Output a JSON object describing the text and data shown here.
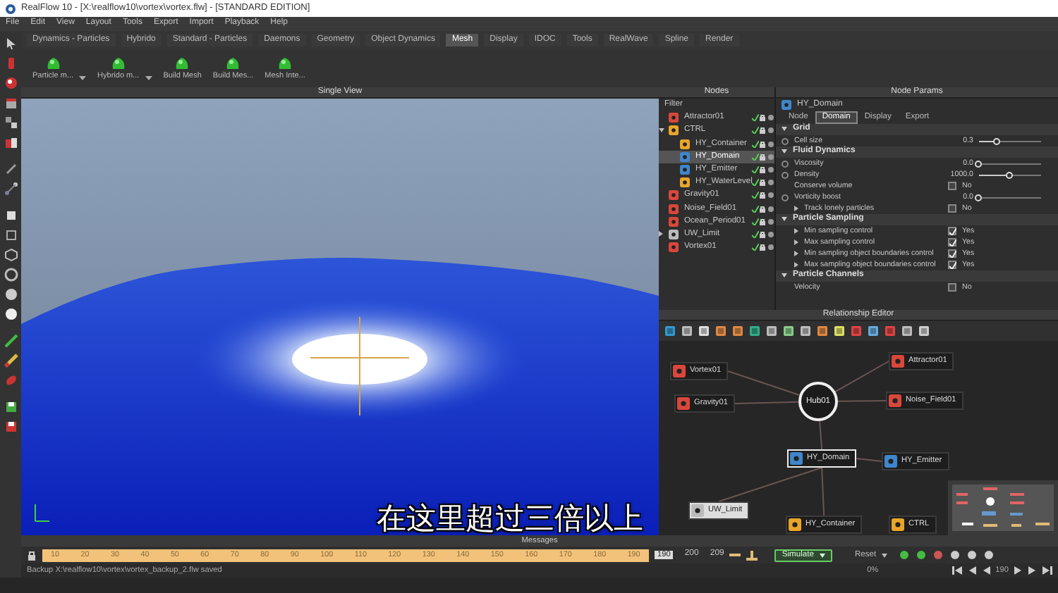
{
  "window": {
    "title": "RealFlow 10 - [X:\\realflow10\\vortex\\vortex.flw] - [STANDARD EDITION]"
  },
  "menu": [
    "File",
    "Edit",
    "View",
    "Layout",
    "Tools",
    "Export",
    "Import",
    "Playback",
    "Help"
  ],
  "shelf_tabs": [
    {
      "label": "Dynamics - Particles",
      "selected": false
    },
    {
      "label": "Hybrido",
      "selected": false
    },
    {
      "label": "Standard - Particles",
      "selected": false
    },
    {
      "label": "Daemons",
      "selected": false
    },
    {
      "label": "Geometry",
      "selected": false
    },
    {
      "label": "Object Dynamics",
      "selected": false
    },
    {
      "label": "Mesh",
      "selected": true
    },
    {
      "label": "Display",
      "selected": false
    },
    {
      "label": "IDOC",
      "selected": false
    },
    {
      "label": "Tools",
      "selected": false
    },
    {
      "label": "RealWave",
      "selected": false
    },
    {
      "label": "Spline",
      "selected": false
    },
    {
      "label": "Render",
      "selected": false
    }
  ],
  "shelf_tools": [
    {
      "label": "Particle m...",
      "menu": true
    },
    {
      "label": "Hybrido m...",
      "menu": true
    },
    {
      "label": "Build Mesh",
      "menu": false
    },
    {
      "label": "Build Mes...",
      "menu": false
    },
    {
      "label": "Mesh Inte...",
      "menu": false
    }
  ],
  "viewport": {
    "title": "Single View",
    "subtitle": "在这里超过三倍以上"
  },
  "nodes_panel": {
    "title": "Nodes",
    "filter_label": "Filter",
    "items": [
      {
        "label": "Attractor01",
        "color": "#d9473c",
        "selected": false
      },
      {
        "label": "CTRL",
        "color": "#e8a52a",
        "selected": false,
        "expanded": true,
        "children": [
          {
            "label": "HY_Container",
            "color": "#e8a52a",
            "selected": false
          },
          {
            "label": "HY_Domain",
            "color": "#3f86cc",
            "selected": true
          },
          {
            "label": "HY_Emitter",
            "color": "#3f86cc",
            "selected": false
          },
          {
            "label": "HY_WaterLevel",
            "color": "#e8a52a",
            "selected": false
          }
        ]
      },
      {
        "label": "Gravity01",
        "color": "#d9473c",
        "selected": false
      },
      {
        "label": "Noise_Field01",
        "color": "#d9473c",
        "selected": false
      },
      {
        "label": "Ocean_Period01",
        "color": "#d9473c",
        "selected": false
      },
      {
        "label": "UW_Limit",
        "color": "#bbbbbb",
        "selected": false,
        "expanded": false
      },
      {
        "label": "Vortex01",
        "color": "#d9473c",
        "selected": false
      }
    ]
  },
  "params_panel": {
    "title": "Node Params",
    "node": "HY_Domain",
    "tabs": [
      {
        "label": "Node",
        "selected": false
      },
      {
        "label": "Domain",
        "selected": true
      },
      {
        "label": "Display",
        "selected": false
      },
      {
        "label": "Export",
        "selected": false
      }
    ],
    "sections": [
      {
        "title": "Grid",
        "expanded": true,
        "rows": [
          {
            "kind": "slider",
            "label": "Cell size",
            "value": "0.3",
            "level": 0.3,
            "expandable": false
          }
        ]
      },
      {
        "title": "Fluid Dynamics",
        "expanded": true,
        "rows": [
          {
            "kind": "slider",
            "label": "Viscosity",
            "value": "0.0",
            "level": 0,
            "expandable": false
          },
          {
            "kind": "slider",
            "label": "Density",
            "value": "1000.0",
            "level": 0.5,
            "expandable": false
          },
          {
            "kind": "checkbox",
            "label": "Conserve volume",
            "value": "No",
            "checked": false,
            "expandable": false
          },
          {
            "kind": "slider",
            "label": "Vorticity boost",
            "value": "0.0",
            "level": 0,
            "expandable": false
          },
          {
            "kind": "checkbox",
            "label": "Track lonely particles",
            "value": "No",
            "checked": false,
            "expandable": true
          }
        ]
      },
      {
        "title": "Particle Sampling",
        "expanded": true,
        "rows": [
          {
            "kind": "checkbox",
            "label": "Min sampling control",
            "value": "Yes",
            "checked": true,
            "expandable": true
          },
          {
            "kind": "checkbox",
            "label": "Max sampling control",
            "value": "Yes",
            "checked": true,
            "expandable": true
          },
          {
            "kind": "checkbox",
            "label": "Min sampling object boundaries control",
            "value": "Yes",
            "checked": true,
            "expandable": true
          },
          {
            "kind": "checkbox",
            "label": "Max sampling object boundaries control",
            "value": "Yes",
            "checked": true,
            "expandable": true
          }
        ]
      },
      {
        "title": "Particle Channels",
        "expanded": true,
        "rows": [
          {
            "kind": "checkbox",
            "label": "Velocity",
            "value": "No",
            "checked": false,
            "expandable": false
          }
        ]
      }
    ]
  },
  "relationship_editor": {
    "title": "Relationship Editor",
    "nodes": [
      {
        "kind": "node",
        "label": "Vortex01",
        "color": "#d9473c",
        "selected": false
      },
      {
        "kind": "node",
        "label": "Gravity01",
        "color": "#d9473c",
        "selected": false
      },
      {
        "kind": "hub",
        "label": "Hub01",
        "selected": false
      },
      {
        "kind": "node",
        "label": "Attractor01",
        "color": "#d9473c",
        "selected": false
      },
      {
        "kind": "node",
        "label": "Noise_Field01",
        "color": "#d9473c",
        "selected": false
      },
      {
        "kind": "node",
        "label": "HY_Domain",
        "color": "#3f86cc",
        "selected": true
      },
      {
        "kind": "node",
        "label": "HY_Emitter",
        "color": "#3f86cc",
        "selected": false
      },
      {
        "kind": "node",
        "label": "UW_Limit",
        "color": "#bbbbbb",
        "selected": false
      },
      {
        "kind": "node",
        "label": "HY_Container",
        "color": "#e8a52a",
        "selected": false
      },
      {
        "kind": "node",
        "label": "CTRL",
        "color": "#e8a52a",
        "selected": false
      }
    ]
  },
  "messages": {
    "title": "Messages"
  },
  "timeline": {
    "ticks": [
      "10",
      "20",
      "30",
      "40",
      "50",
      "60",
      "70",
      "80",
      "90",
      "100",
      "110",
      "120",
      "130",
      "140",
      "150",
      "160",
      "170",
      "180",
      "190"
    ],
    "current_frame": "190",
    "end_frames": [
      "200",
      "209"
    ],
    "simulate_label": "Simulate",
    "reset_label": "Reset"
  },
  "status_bar": {
    "message": "Backup X:\\realflow10\\vortex\\vortex_backup_2.flw saved",
    "progress": "0%",
    "frame": "190"
  }
}
